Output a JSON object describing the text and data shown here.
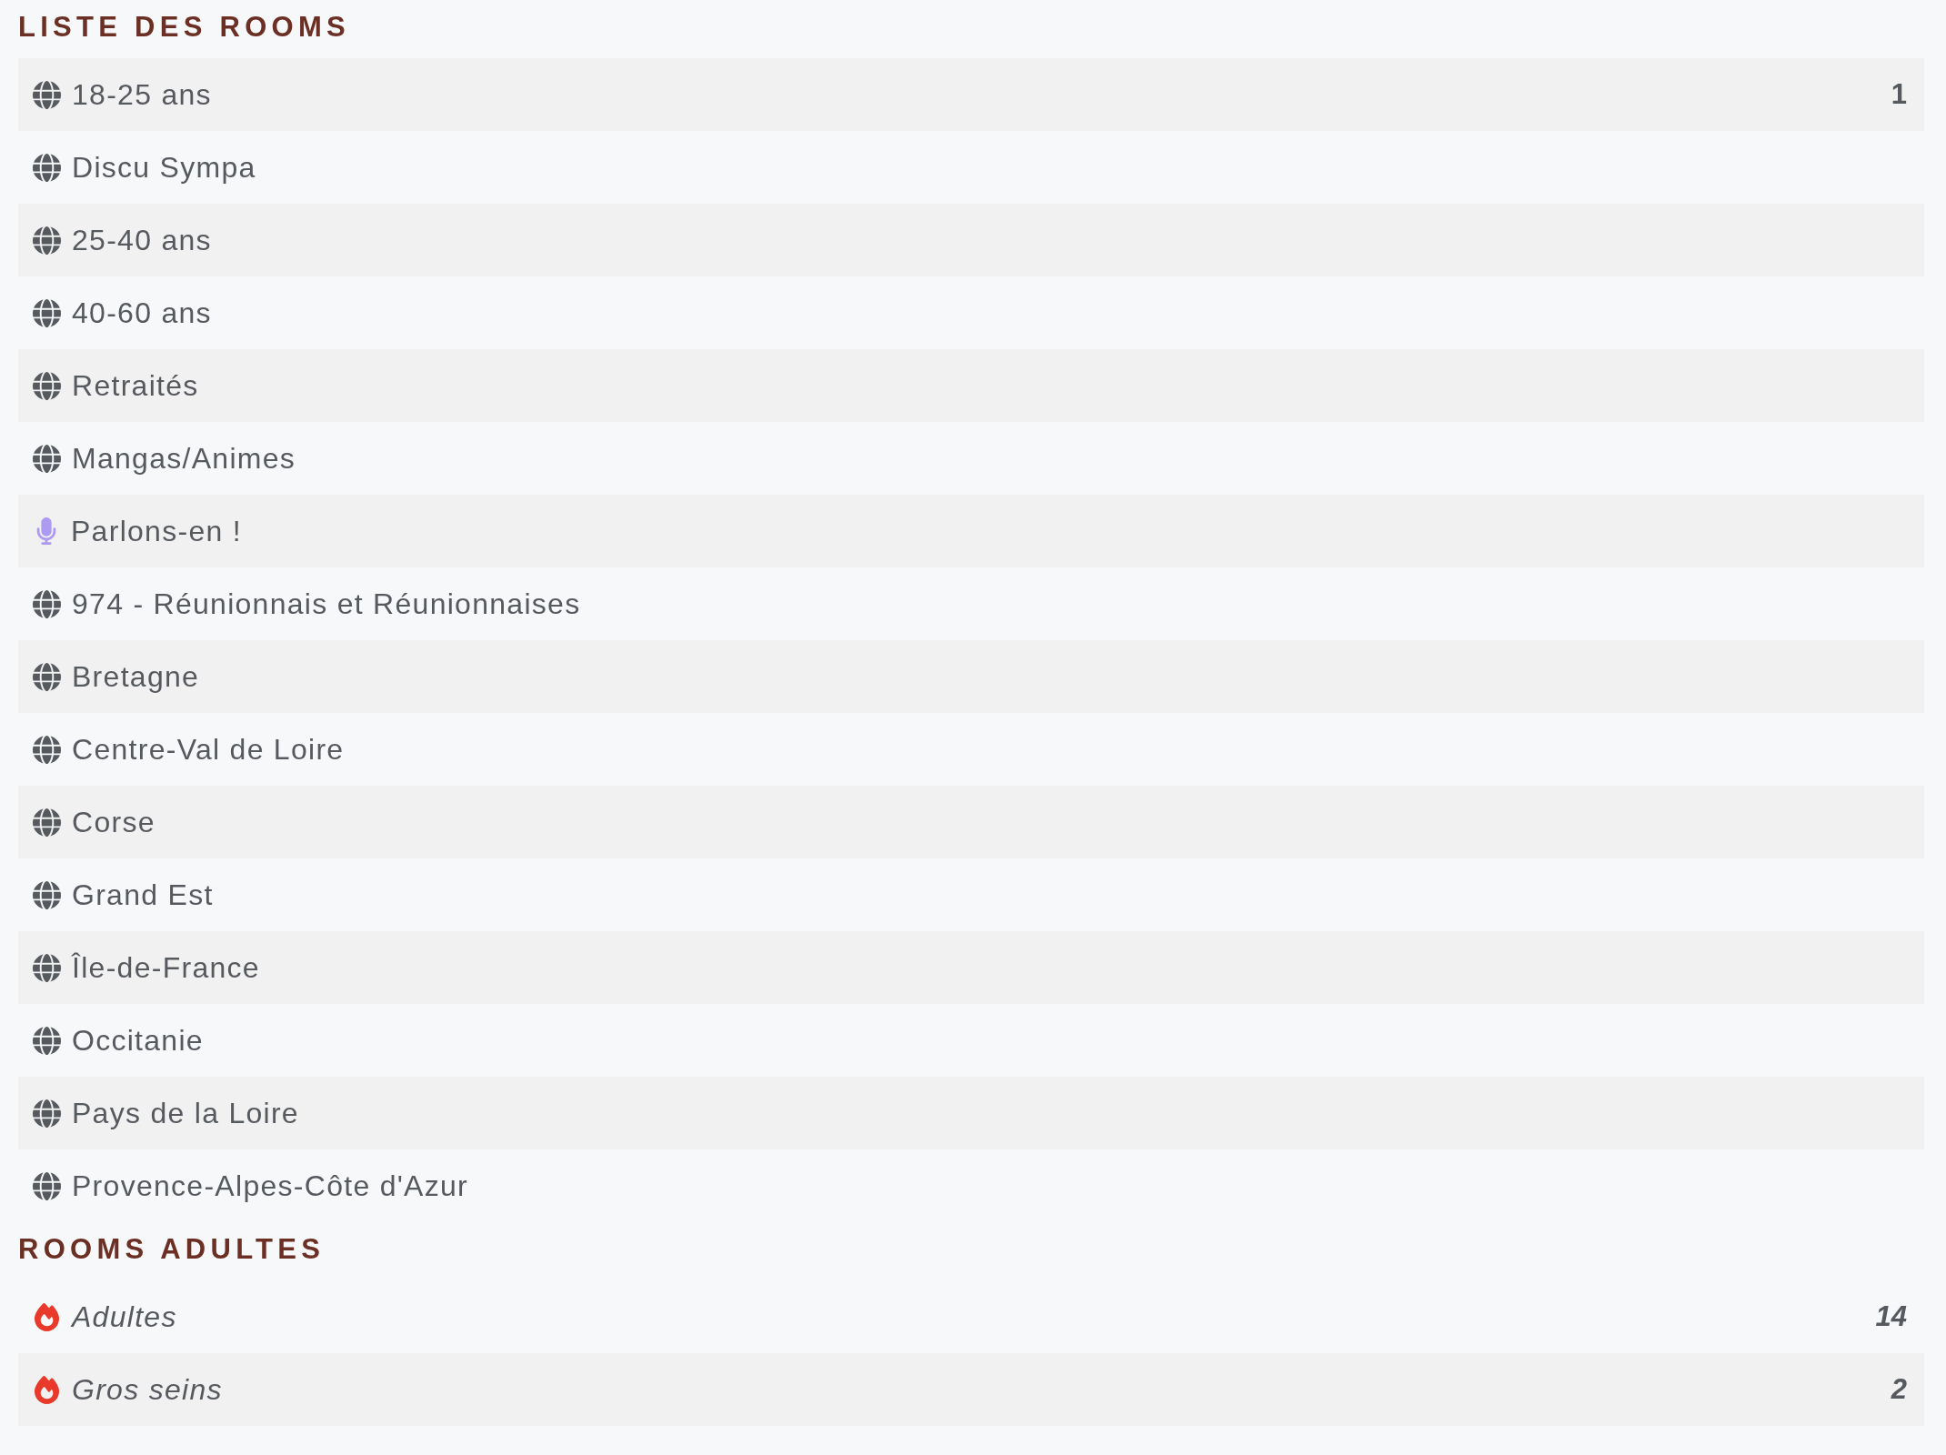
{
  "sections": [
    {
      "title": "LISTE DES ROOMS",
      "rooms": [
        {
          "kind": "text",
          "name": "18-25 ans",
          "count": "1"
        },
        {
          "kind": "text",
          "name": "Discu Sympa"
        },
        {
          "kind": "text",
          "name": "25-40 ans"
        },
        {
          "kind": "text",
          "name": "40-60 ans"
        },
        {
          "kind": "text",
          "name": "Retraités"
        },
        {
          "kind": "text",
          "name": "Mangas/Animes"
        },
        {
          "kind": "voice",
          "name": "Parlons-en !"
        },
        {
          "kind": "text",
          "name": "974 - Réunionnais et Réunionnaises"
        },
        {
          "kind": "text",
          "name": "Bretagne"
        },
        {
          "kind": "text",
          "name": "Centre-Val de Loire"
        },
        {
          "kind": "text",
          "name": "Corse"
        },
        {
          "kind": "text",
          "name": "Grand Est"
        },
        {
          "kind": "text",
          "name": "Île-de-France"
        },
        {
          "kind": "text",
          "name": "Occitanie"
        },
        {
          "kind": "text",
          "name": "Pays de la Loire"
        },
        {
          "kind": "text",
          "name": "Provence-Alpes-Côte d'Azur"
        }
      ]
    },
    {
      "title": "ROOMS ADULTES",
      "rooms": [
        {
          "kind": "adult",
          "name": "Adultes",
          "count": "14"
        },
        {
          "kind": "adult",
          "name": "Gros seins",
          "count": "2"
        }
      ]
    }
  ]
}
